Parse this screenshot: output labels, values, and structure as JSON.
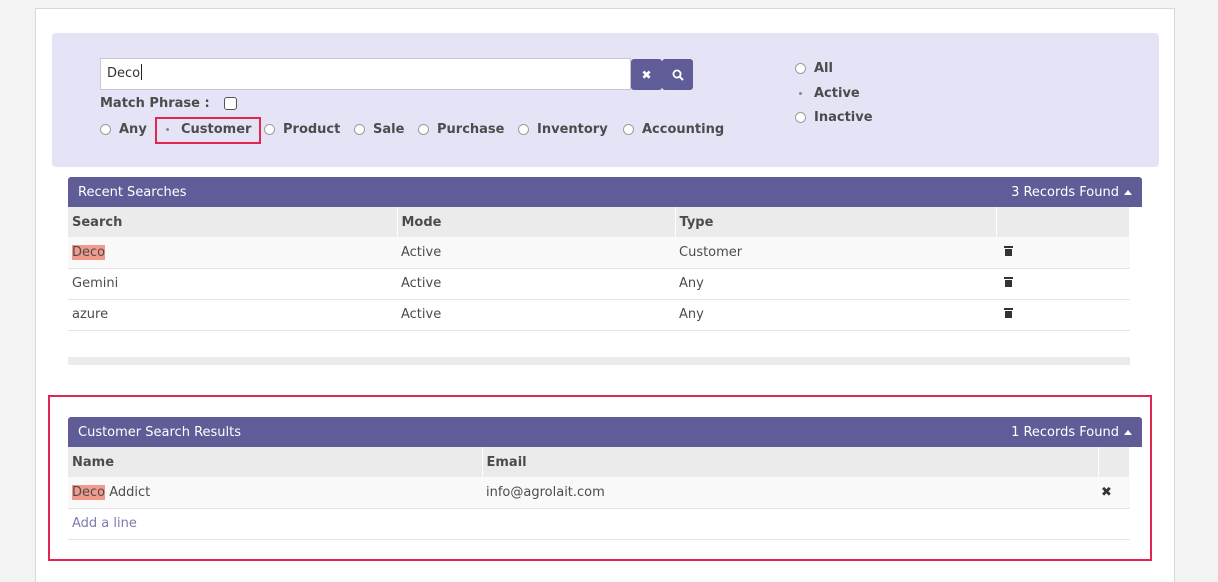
{
  "search": {
    "value": "Deco",
    "clear_icon": "times-icon",
    "search_icon": "search-icon",
    "match_phrase_label": "Match Phrase :",
    "types": [
      "Any",
      "Customer",
      "Product",
      "Sale",
      "Purchase",
      "Inventory",
      "Accounting"
    ],
    "selected_type": "Customer",
    "modes": [
      "All",
      "Active",
      "Inactive"
    ],
    "selected_mode": "Active"
  },
  "recent": {
    "title": "Recent Searches",
    "count": "3 Records Found",
    "columns": [
      "Search",
      "Mode",
      "Type"
    ],
    "rows": [
      {
        "search": "Deco",
        "mode": "Active",
        "type": "Customer"
      },
      {
        "search": "Gemini",
        "mode": "Active",
        "type": "Any"
      },
      {
        "search": "azure",
        "mode": "Active",
        "type": "Any"
      }
    ]
  },
  "results": {
    "title": "Customer Search Results",
    "count": "1 Records Found",
    "columns": [
      "Name",
      "Email"
    ],
    "rows": [
      {
        "name_match": "Deco",
        "name_rest": " Addict",
        "email": "info@agrolait.com"
      }
    ],
    "add_line": "Add a line"
  },
  "colors": {
    "header": "#5f5c97",
    "panel": "#e5e4f7",
    "highlight_border": "#e3264f",
    "match": "#f29b8c"
  }
}
